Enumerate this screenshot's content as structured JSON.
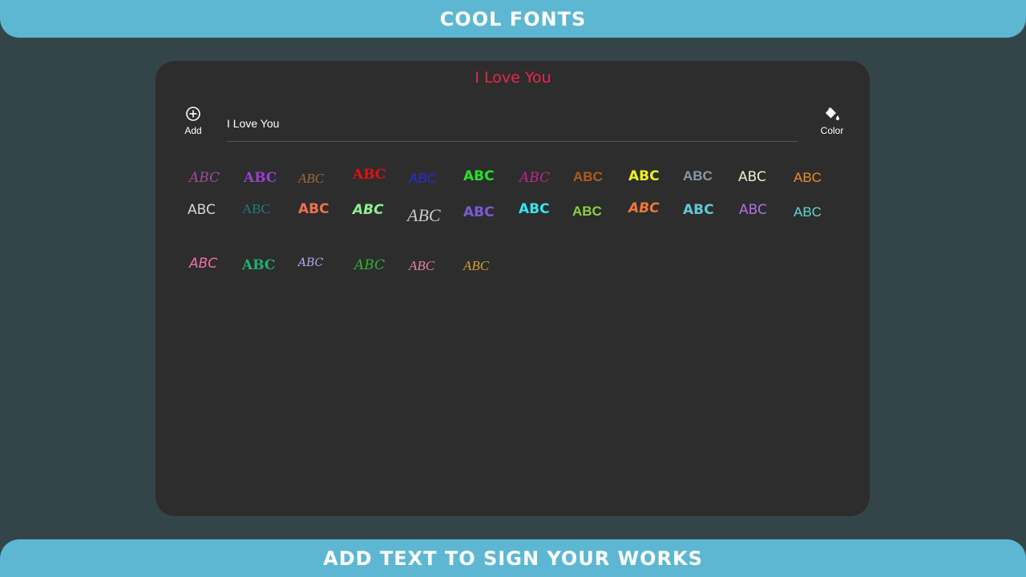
{
  "header": {
    "title": "COOL FONTS"
  },
  "footer": {
    "tagline": "ADD TEXT TO SIGN YOUR WORKS"
  },
  "preview": {
    "text": "I Love You",
    "color": "#e8274b"
  },
  "toolbar": {
    "add_label": "Add",
    "color_label": "Color"
  },
  "input": {
    "value": "I Love You"
  },
  "fonts": [
    {
      "label": "ABC",
      "color": "#a24aa0"
    },
    {
      "label": "ABC",
      "color": "#9b3fd1"
    },
    {
      "label": "ABC",
      "color": "#9a6a3a"
    },
    {
      "label": "ABC",
      "color": "#e01010"
    },
    {
      "label": "ABC",
      "color": "#2a2ae0"
    },
    {
      "label": "ABC",
      "color": "#28e028"
    },
    {
      "label": "ABC",
      "color": "#c0268c"
    },
    {
      "label": "ABC",
      "color": "#b35a1a"
    },
    {
      "label": "ABC",
      "color": "#f0f020"
    },
    {
      "label": "ABC",
      "color": "#8a96a8"
    },
    {
      "label": "ABC",
      "color": "#eeeecc"
    },
    {
      "label": "ABC",
      "color": "#e89030"
    },
    {
      "label": "ABC",
      "color": "#cfd6dc"
    },
    {
      "label": "ABC",
      "color": "#1e7e7a"
    },
    {
      "label": "ABC",
      "color": "#f07050"
    },
    {
      "label": "ABC",
      "color": "#90f090"
    },
    {
      "label": "ABC",
      "color": "#c8c8c8"
    },
    {
      "label": "ABC",
      "color": "#7a5ad8"
    },
    {
      "label": "ABC",
      "color": "#30e8f0"
    },
    {
      "label": "ABC",
      "color": "#88d040"
    },
    {
      "label": "ABC",
      "color": "#f07838"
    },
    {
      "label": "ABC",
      "color": "#60c8d8"
    },
    {
      "label": "ABC",
      "color": "#b070e8"
    },
    {
      "label": "ABC",
      "color": "#60d8d0"
    },
    {
      "label": "ABC",
      "color": "#f070a8"
    },
    {
      "label": "ABC",
      "color": "#20b070"
    },
    {
      "label": "ABC",
      "color": "#b8a8f0"
    },
    {
      "label": "ABC",
      "color": "#30b030"
    },
    {
      "label": "ABC",
      "color": "#e080a0"
    },
    {
      "label": "ABC",
      "color": "#d0a030"
    }
  ]
}
